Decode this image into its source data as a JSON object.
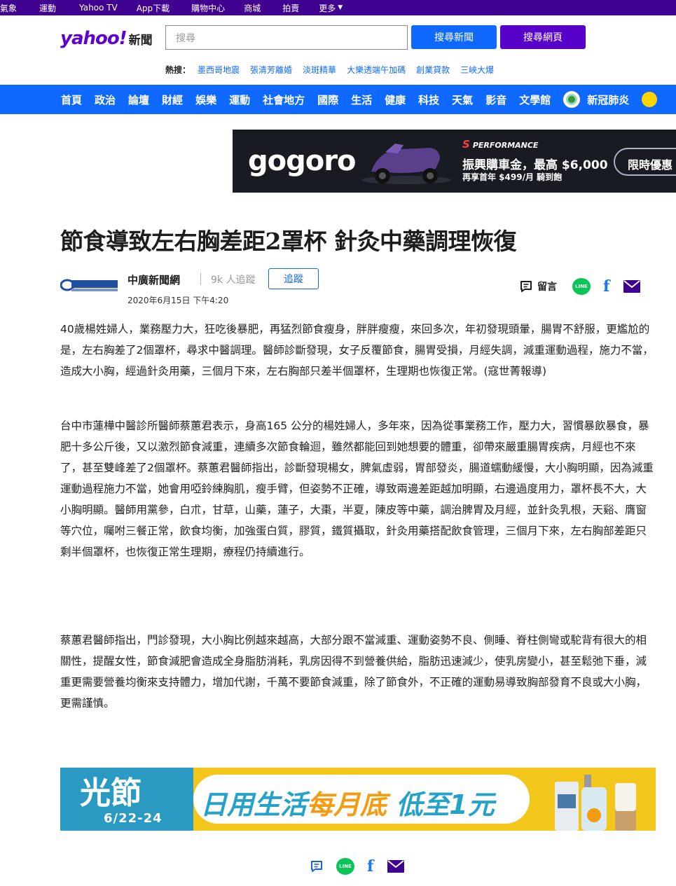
{
  "topbar": {
    "items": [
      "氣象",
      "運動",
      "Yahoo TV",
      "App下載",
      "購物中心",
      "商城",
      "拍賣",
      "更多"
    ]
  },
  "header": {
    "logo_text": "yahoo!",
    "logo_section": "新聞",
    "search_placeholder": "搜尋",
    "search_news_label": "搜尋新聞",
    "search_web_label": "搜尋網頁"
  },
  "trending": {
    "label": "熱搜：",
    "terms": [
      "墨西哥地震",
      "張清芳離婚",
      "淡斑精華",
      "大樂透端午加碼",
      "創業貸款",
      "三峽大爆"
    ]
  },
  "nav": {
    "items": [
      "首頁",
      "政治",
      "論壇",
      "財經",
      "娛樂",
      "運動",
      "社會地方",
      "國際",
      "生活",
      "健康",
      "科技",
      "天氣",
      "影音",
      "文學館"
    ],
    "covid": "新冠肺炎"
  },
  "ad_top": {
    "brand": "gogoro",
    "perf_mark": "S",
    "perf": "PERFORMANCE",
    "line1": "振興購車金，最高 $6,000",
    "line2": "再享首年 $499/月 騎到飽",
    "cta": "限時優惠"
  },
  "article": {
    "title": "節食導致左右胸差距2罩杯 針灸中藥調理恢復",
    "provider": "中廣新聞網",
    "followers": "9k 人追蹤",
    "follow_label": "追蹤",
    "date": "2020年6月15日 下午4:20",
    "comment_label": "留言",
    "paragraphs": [
      "40歲楊姓婦人，業務壓力大，狂吃後暴肥，再猛烈節食瘦身，胖胖瘦瘦，來回多次，年初發現頭暈，腸胃不舒服，更尷尬的是，左右胸差了2個罩杯，尋求中醫調理。醫師診斷發現，女子反覆節食，腸胃受損，月經失調，減重運動過程，施力不當，造成大小胸，經過針灸用藥，三個月下來，左右胸部只差半個罩杯，生理期也恢復正常。(寇世菁報導)",
      "台中市蓮樺中醫診所醫師蔡蕙君表示，身高165 公分的楊姓婦人，多年來，因為從事業務工作，壓力大，習慣暴飲暴食，暴肥十多公斤後，又以激烈節食減重，連續多次節食輪迴，雖然都能回到她想要的體重，卻帶來嚴重腸胃疾病，月經也不來了，甚至雙峰差了2個罩杯。蔡蕙君醫師指出，診斷發現楊女，脾氣虛弱，胃部發炎，腸道蠕動緩慢，大小胸明顯，因為減重運動過程施力不當，她會用啞鈴練胸肌，瘦手臂，但姿勢不正確，導致兩邊差距越加明顯，右邊過度用力，罩杯長不大，大小胸明顯。醫師用黨參，白朮，甘草，山藥，蓮子，大棗，半夏，陳皮等中藥，調治脾胃及月經，並針灸乳根，天谿、膺窗等穴位，囑咐三餐正常，飲食均衡，加強蛋白質，膠質，鐵質攝取，針灸用藥搭配飲食管理，三個月下來，左右胸部差距只剩半個罩杯，也恢復正常生理期，療程仍持續進行。",
      "蔡蕙君醫師指出，門診發現，大小胸比例越來越高，大部分跟不當減重、運動姿勢不良、側睡、脊柱側彎或駝背有很大的相關性，提醒女性，節食減肥會造成全身脂肪消耗，乳房因得不到營養供給，脂肪迅速減少，使乳房變小，甚至鬆弛下垂，減重更需要營養均衡來支持體力，增加代謝，千萬不要節食減重，除了節食外，不正確的運動易導致胸部發育不良或大小胸，更需謹慎。"
    ]
  },
  "ad_bottom": {
    "festival": "光節",
    "dates": "6/22-24",
    "slogan_a": "日用生活",
    "slogan_b": "每月底",
    "slogan_c": " 低至1元"
  },
  "icons": {
    "share": [
      "comment-icon",
      "line-icon",
      "facebook-icon",
      "mail-icon"
    ],
    "line_text": "LINE",
    "facebook_text": "f"
  },
  "colors": {
    "topbar": "#400090",
    "nav": "#0f69ff",
    "search_news": "#0f69ff",
    "search_web": "#5600c9",
    "mail": "#400090",
    "line": "#06c755",
    "facebook": "#1877f2"
  }
}
